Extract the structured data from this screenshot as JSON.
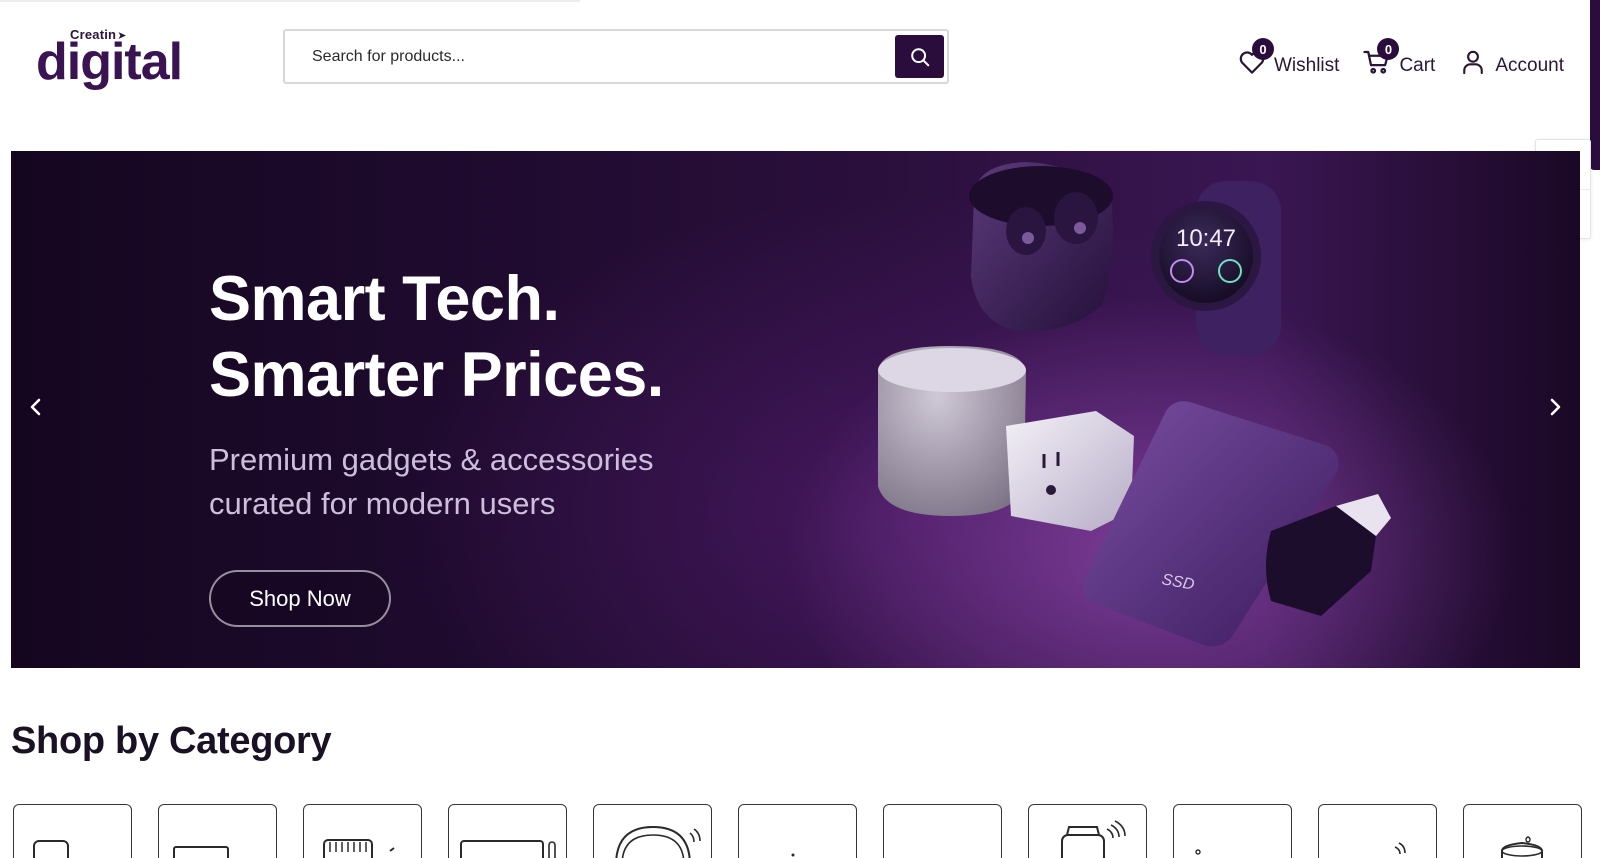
{
  "header": {
    "logo_small": "Creatin",
    "logo_main": "digital",
    "search": {
      "placeholder": "Search for products..."
    },
    "wishlist": {
      "label": "Wishlist",
      "count": "0"
    },
    "cart": {
      "label": "Cart",
      "count": "0"
    },
    "account": {
      "label": "Account"
    }
  },
  "hero": {
    "title_line1": "Smart Tech.",
    "title_line2": "Smarter Prices.",
    "subtitle_line1": "Premium gadgets & accessories",
    "subtitle_line2": "curated for modern users",
    "cta_label": "Shop Now",
    "watch_time": "10:47",
    "ssd_label": "SSD"
  },
  "categories": {
    "title": "Shop by Category",
    "items": [
      {
        "icon": "phone-icon"
      },
      {
        "icon": "laptop-icon"
      },
      {
        "icon": "router-icon"
      },
      {
        "icon": "tv-icon"
      },
      {
        "icon": "headphones-icon"
      },
      {
        "icon": "accessory-icon"
      },
      {
        "icon": "accessory-icon"
      },
      {
        "icon": "smartwatch-icon"
      },
      {
        "icon": "accessory-icon"
      },
      {
        "icon": "wireless-icon"
      },
      {
        "icon": "smart-home-icon"
      }
    ]
  },
  "colors": {
    "brand": "#2b0d3d",
    "logo": "#3a1352",
    "widget_green": "#3aa86b"
  }
}
